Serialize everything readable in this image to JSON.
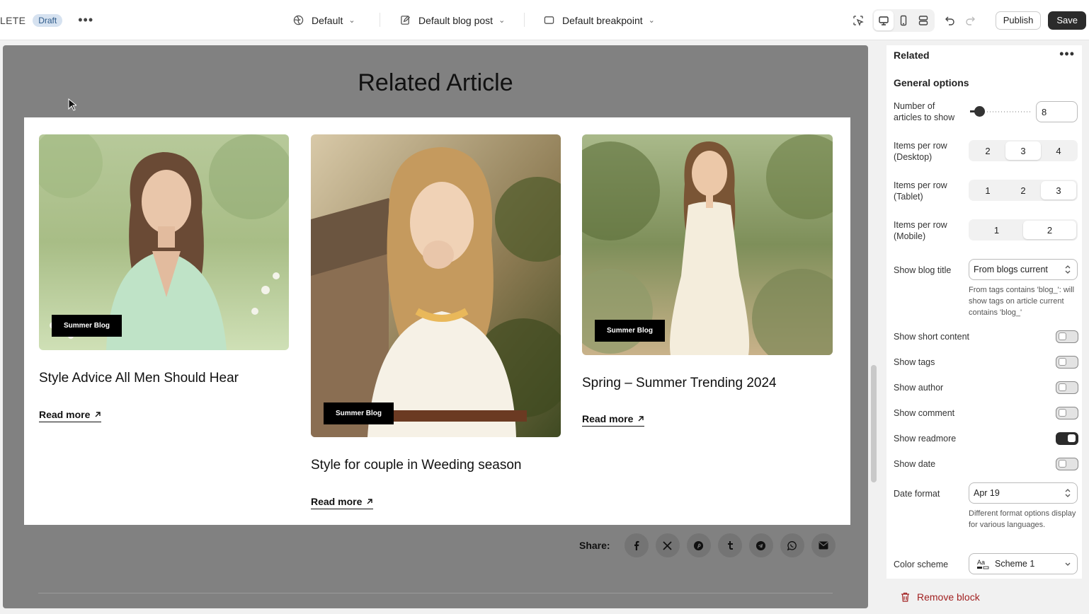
{
  "topbar": {
    "app_name": "LETE",
    "status_badge": "Draft",
    "theme_select": "Default",
    "template_select": "Default blog post",
    "breakpoint_select": "Default breakpoint",
    "publish_label": "Publish",
    "save_label": "Save"
  },
  "canvas": {
    "section_title": "Related Article",
    "articles": [
      {
        "tag": "Summer Blog",
        "title": "Style Advice All Men Should Hear",
        "readmore": "Read more"
      },
      {
        "tag": "Summer Blog",
        "title": "Style for couple in Weeding season",
        "readmore": "Read more"
      },
      {
        "tag": "Summer Blog",
        "title": "Spring – Summer Trending 2024",
        "readmore": "Read more"
      }
    ],
    "share_label": "Share:",
    "share_icons": [
      "facebook-icon",
      "x-icon",
      "pinterest-icon",
      "tumblr-icon",
      "telegram-icon",
      "whatsapp-icon",
      "email-icon"
    ]
  },
  "panel": {
    "title": "Related",
    "section": "General options",
    "articles_label": "Number of articles to show",
    "articles_value": "8",
    "articles_slider_value": 8,
    "desktop_label": "Items per row (Desktop)",
    "desktop_options": [
      "2",
      "3",
      "4"
    ],
    "desktop_selected": "3",
    "tablet_label": "Items per row (Tablet)",
    "tablet_options": [
      "1",
      "2",
      "3"
    ],
    "tablet_selected": "3",
    "mobile_label": "Items per row (Mobile)",
    "mobile_options": [
      "1",
      "2"
    ],
    "mobile_selected": "2",
    "blog_title_label": "Show blog title",
    "blog_title_value": "From blogs current",
    "blog_title_hint": "From tags contains 'blog_': will show tags on article current contains 'blog_'",
    "short_content_label": "Show short content",
    "short_content_on": false,
    "tags_label": "Show tags",
    "tags_on": false,
    "author_label": "Show author",
    "author_on": false,
    "comment_label": "Show comment",
    "comment_on": false,
    "readmore_label": "Show readmore",
    "readmore_on": true,
    "date_label": "Show date",
    "date_on": false,
    "date_format_label": "Date format",
    "date_format_value": "Apr 19",
    "date_format_hint": "Different format options display for various languages.",
    "color_scheme_label": "Color scheme",
    "color_scheme_value": "Scheme 1",
    "remove_label": "Remove block"
  }
}
